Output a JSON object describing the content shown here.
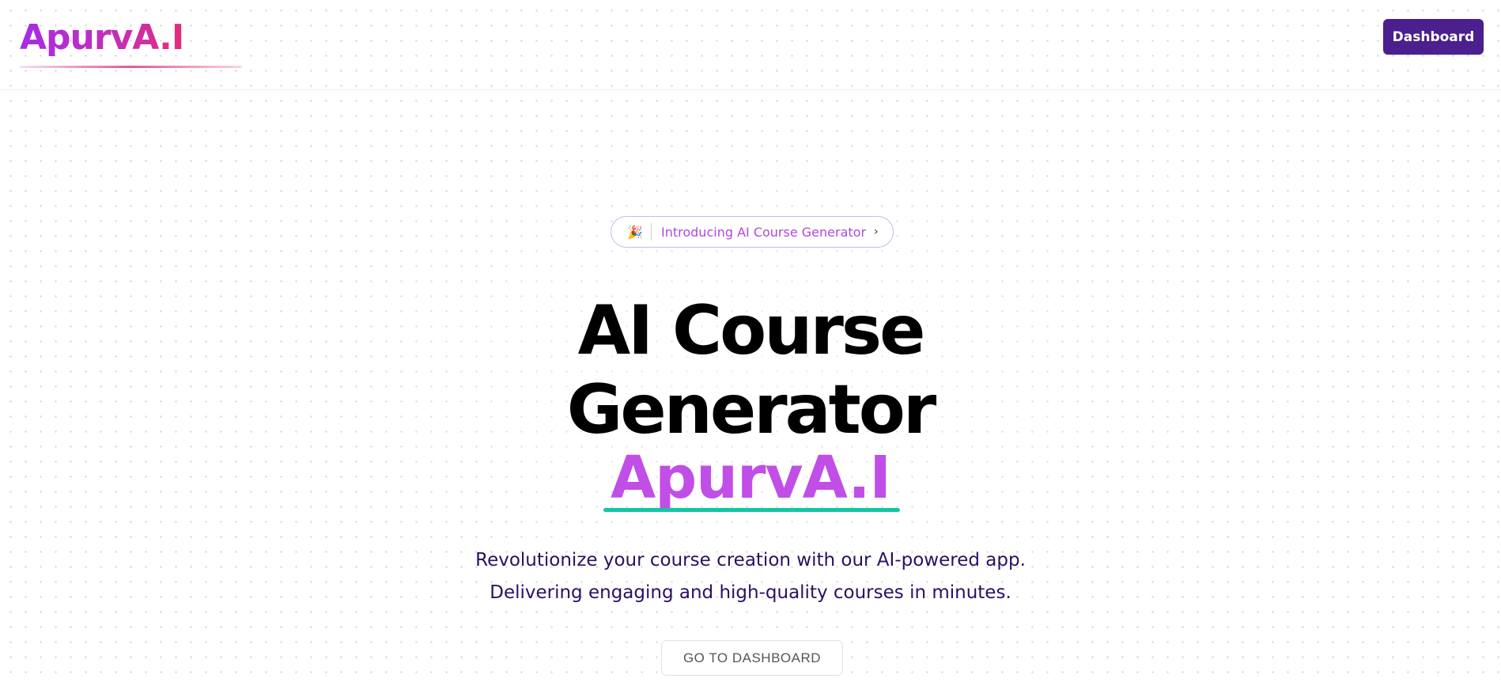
{
  "header": {
    "logo": "ApurvA.I",
    "dashboard_label": "Dashboard"
  },
  "announcement": {
    "emoji": "🎉",
    "text": "Introducing AI Course Generator",
    "chevron": "›"
  },
  "hero": {
    "title_line1": "AI Course",
    "title_line2": "Generator",
    "brand": "ApurvA.I",
    "subtitle_line1": "Revolutionize your course creation with our AI-powered app.",
    "subtitle_line2": "Delivering engaging and high-quality courses in minutes.",
    "cta_label": "GO TO DASHBOARD"
  },
  "colors": {
    "primary_button": "#4b1f8e",
    "brand_purple": "#c14ee6",
    "underline_teal": "#12c6a3",
    "subtitle_text": "#2c0f63"
  }
}
